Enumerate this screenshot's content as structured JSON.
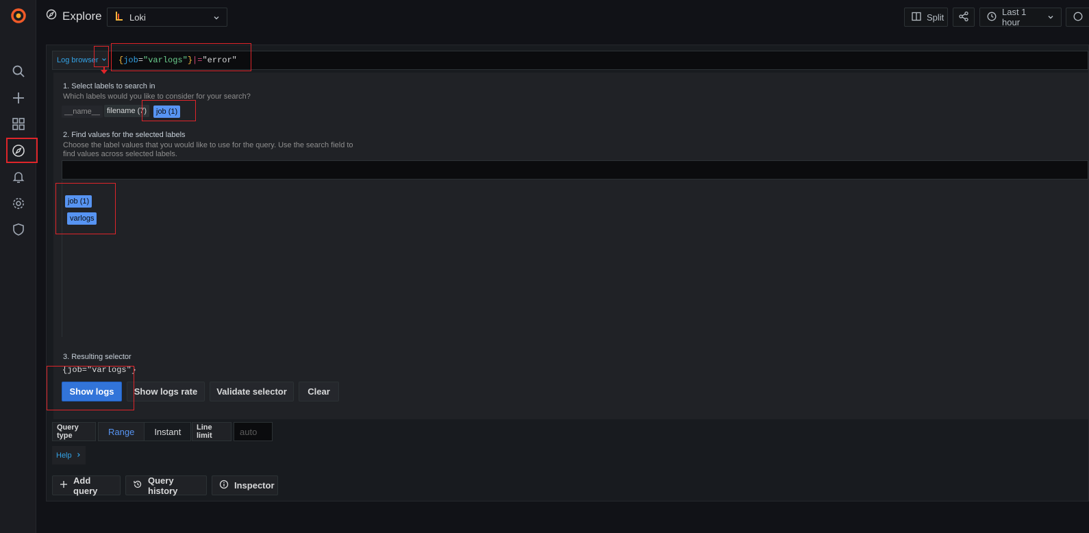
{
  "topbar": {
    "title": "Explore",
    "datasource": "Loki",
    "split_label": "Split",
    "time_range": "Last 1 hour"
  },
  "sidebar": {
    "items": [
      {
        "icon": "search-icon"
      },
      {
        "icon": "plus-icon"
      },
      {
        "icon": "dashboards-icon"
      },
      {
        "icon": "compass-icon",
        "active": true
      },
      {
        "icon": "bell-icon"
      },
      {
        "icon": "gear-icon"
      },
      {
        "icon": "shield-icon"
      }
    ]
  },
  "query": {
    "log_browser_label": "Log browser",
    "tokens": {
      "open": "{",
      "label": "job",
      "eq": "=",
      "value": "\"varlogs\"",
      "close": "}",
      "pipe": "|=",
      "filter": "\"error\""
    }
  },
  "browser": {
    "step1": {
      "title": "1. Select labels to search in",
      "desc": "Which labels would you like to consider for your search?",
      "labels": [
        "__name__",
        "filename (7)",
        "job (1)"
      ]
    },
    "step2": {
      "title": "2. Find values for the selected labels",
      "desc_line1": "Choose the label values that you would like to use for the query. Use the search field to",
      "desc_line2": "find values across selected labels.",
      "value_group_label": "job (1)",
      "values": [
        "varlogs"
      ]
    },
    "step3": {
      "title": "3. Resulting selector",
      "selector": "{job=\"varlogs\"}"
    },
    "buttons": {
      "show_logs": "Show logs",
      "show_logs_rate": "Show logs rate",
      "validate": "Validate selector",
      "clear": "Clear"
    }
  },
  "options": {
    "query_type_label": "Query type",
    "range": "Range",
    "instant": "Instant",
    "line_limit_label": "Line limit",
    "line_limit_placeholder": "auto",
    "help_label": "Help"
  },
  "actions": {
    "add_query": "Add query",
    "query_history": "Query history",
    "inspector": "Inspector"
  },
  "colors": {
    "accent_blue": "#5794f2",
    "primary_button": "#3274d9",
    "annotation_red": "#e0252a",
    "query_label": "#33a2e5",
    "query_string": "#6ccf8e",
    "query_brace": "#f5b73d",
    "query_operator": "#d44a7a"
  }
}
